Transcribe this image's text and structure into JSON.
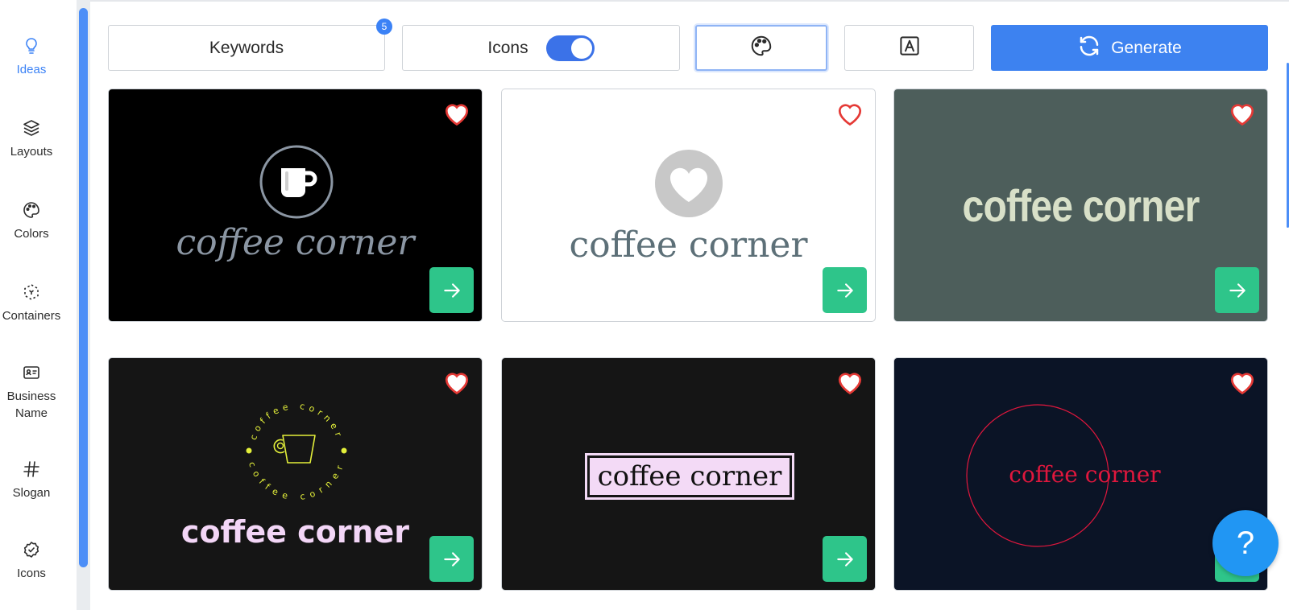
{
  "sidebar": {
    "items": [
      {
        "label": "Ideas",
        "icon": "lightbulb-icon"
      },
      {
        "label": "Layouts",
        "icon": "layers-icon"
      },
      {
        "label": "Colors",
        "icon": "palette-icon"
      },
      {
        "label": "Containers",
        "icon": "containers-icon"
      },
      {
        "label": "Business\nName",
        "icon": "id-card-icon"
      },
      {
        "label": "Slogan",
        "icon": "hash-icon"
      },
      {
        "label": "Icons",
        "icon": "badge-check-icon"
      }
    ]
  },
  "toolbar": {
    "keywords_label": "Keywords",
    "keywords_count": "5",
    "icons_label": "Icons",
    "icons_toggle_on": true,
    "generate_label": "Generate"
  },
  "cards": [
    {
      "text": "coffee corner",
      "bg": "#000000",
      "fg": "#8b96a3"
    },
    {
      "text": "coffee corner",
      "bg": "#ffffff",
      "fg": "#5d7078"
    },
    {
      "text": "coffee corner",
      "bg": "#4d5e5b",
      "fg": "#d8e0c8"
    },
    {
      "text": "coffee corner",
      "bg": "#151515",
      "fg": "#f3d6f7",
      "ring_text": "coffee corner",
      "ring_color": "#e3ef3a"
    },
    {
      "text": "coffee corner",
      "bg": "#151515",
      "fg": "#111111",
      "box_bg": "#f3daf6"
    },
    {
      "text": "coffee corner",
      "bg": "#0b1426",
      "fg": "#e0173d"
    }
  ],
  "colors": {
    "accent": "#3d82f0",
    "go": "#2ec58a",
    "heart": "#e53935",
    "help": "#2196f3"
  },
  "help_label": "?"
}
